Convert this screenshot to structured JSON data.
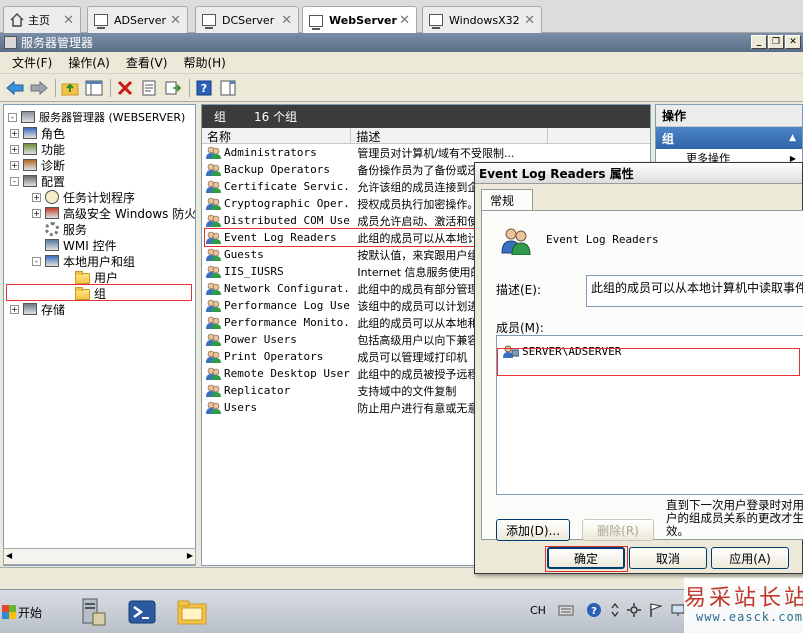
{
  "tabs": [
    {
      "label": "主页"
    },
    {
      "label": "ADServer"
    },
    {
      "label": "DCServer"
    },
    {
      "label": "WebServer",
      "active": true
    },
    {
      "label": "WindowsX32"
    }
  ],
  "window": {
    "title": "服务器管理器"
  },
  "menu": [
    "文件(F)",
    "操作(A)",
    "查看(V)",
    "帮助(H)"
  ],
  "tree": [
    {
      "label": "服务器管理器 (WEBSERVER)",
      "level": 0,
      "expander": "-",
      "icon": "server-manager-icon"
    },
    {
      "label": "角色",
      "level": 1,
      "expander": "+",
      "icon": "roles-icon"
    },
    {
      "label": "功能",
      "level": 1,
      "expander": "+",
      "icon": "features-icon"
    },
    {
      "label": "诊断",
      "level": 1,
      "expander": "+",
      "icon": "diagnostics-icon"
    },
    {
      "label": "配置",
      "level": 1,
      "expander": "-",
      "icon": "configuration-icon"
    },
    {
      "label": "任务计划程序",
      "level": 2,
      "expander": "+",
      "icon": "clock-icon"
    },
    {
      "label": "高级安全 Windows 防火墙",
      "level": 2,
      "expander": "+",
      "icon": "firewall-icon"
    },
    {
      "label": "服务",
      "level": 2,
      "expander": "",
      "icon": "services-gear-icon"
    },
    {
      "label": "WMI 控件",
      "level": 2,
      "expander": "",
      "icon": "wmi-icon"
    },
    {
      "label": "本地用户和组",
      "level": 2,
      "expander": "-",
      "icon": "users-icon"
    },
    {
      "label": "用户",
      "level": 3,
      "expander": "",
      "icon": "folder-icon"
    },
    {
      "label": "组",
      "level": 3,
      "expander": "",
      "icon": "folder-icon",
      "selected": true
    },
    {
      "label": "存储",
      "level": 1,
      "expander": "+",
      "icon": "storage-icon"
    }
  ],
  "list": {
    "title": "组",
    "count": "16 个组",
    "columns": [
      "名称",
      "描述"
    ],
    "rows": [
      {
        "name": "Administrators",
        "desc": "管理员对计算机/域有不受限制..."
      },
      {
        "name": "Backup Operators",
        "desc": "备份操作员为了备份或还原文件"
      },
      {
        "name": "Certificate Servic...",
        "desc": "允许该组的成员连接到企业中的"
      },
      {
        "name": "Cryptographic Oper...",
        "desc": "授权成员执行加密操作。"
      },
      {
        "name": "Distributed COM Users",
        "desc": "成员允许启动、激活和使用此计"
      },
      {
        "name": "Event Log Readers",
        "desc": "此组的成员可以从本地计算机中",
        "highlighted": true
      },
      {
        "name": "Guests",
        "desc": "按默认值，来宾跟用户组的成员"
      },
      {
        "name": "IIS_IUSRS",
        "desc": "Internet 信息服务使用的内置组"
      },
      {
        "name": "Network Configurat...",
        "desc": "此组中的成员有部分管理权限来"
      },
      {
        "name": "Performance Log Users",
        "desc": "该组中的成员可以计划进行性能"
      },
      {
        "name": "Performance Monito...",
        "desc": "此组的成员可以从本地和远程访"
      },
      {
        "name": "Power Users",
        "desc": "包括高级用户以向下兼容，高级"
      },
      {
        "name": "Print Operators",
        "desc": "成员可以管理域打印机"
      },
      {
        "name": "Remote Desktop Users",
        "desc": "此组中的成员被授予远程登录的"
      },
      {
        "name": "Replicator",
        "desc": "支持域中的文件复制"
      },
      {
        "name": "Users",
        "desc": "防止用户进行有意或无意的系统"
      }
    ]
  },
  "actions": {
    "title": "操作",
    "group": "组",
    "item": "更多操作"
  },
  "dialog": {
    "title": "Event Log Readers 属性",
    "tab": "常规",
    "group_name": "Event Log Readers",
    "desc_label": "描述(E):",
    "desc_value": "此组的成员可以从本地计算机中读取事件日志",
    "members_label": "成员(M):",
    "members": [
      "SERVER\\ADSERVER"
    ],
    "add_button": "添加(D)...",
    "remove_button": "删除(R)",
    "note": "直到下一次用户登录时对用户的组成员关系的更改才生效。",
    "ok_button": "确定",
    "cancel_button": "取消",
    "apply_button": "应用(A)"
  },
  "taskbar": {
    "start": "开始",
    "lang": "CH"
  },
  "watermark": {
    "cn": "易采站长站",
    "url": "www.easck.com"
  },
  "colors": {
    "highlight_red": "#e53030",
    "group_header": "#3c3c3c",
    "actions_blue": "#2f64a8"
  }
}
